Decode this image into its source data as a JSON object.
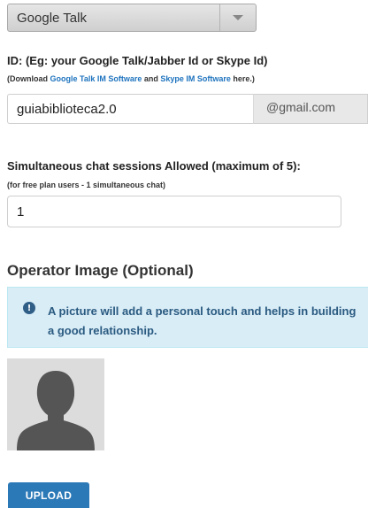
{
  "im_provider": {
    "selected": "Google Talk"
  },
  "id_field": {
    "label": "ID: (Eg: your Google Talk/Jabber Id or Skype Id)",
    "note_prefix": "(Download ",
    "link_google": "Google Talk IM Software",
    "note_and": " and ",
    "link_skype": "Skype IM Software",
    "note_suffix": " here.)",
    "value": "guiabiblioteca2.0",
    "suffix": "@gmail.com"
  },
  "sessions_field": {
    "label": "Simultaneous chat sessions Allowed (maximum of 5):",
    "note": "(for free plan users -  1 simultaneous chat)",
    "value": "1"
  },
  "operator_image": {
    "heading": "Operator Image (Optional)",
    "info_text": "A picture will add a personal touch and helps in building a good relationship.",
    "upload_label": "UPLOAD"
  },
  "colors": {
    "accent": "#2c79b8",
    "info_bg": "#d9edf7",
    "link": "#1e73be"
  }
}
